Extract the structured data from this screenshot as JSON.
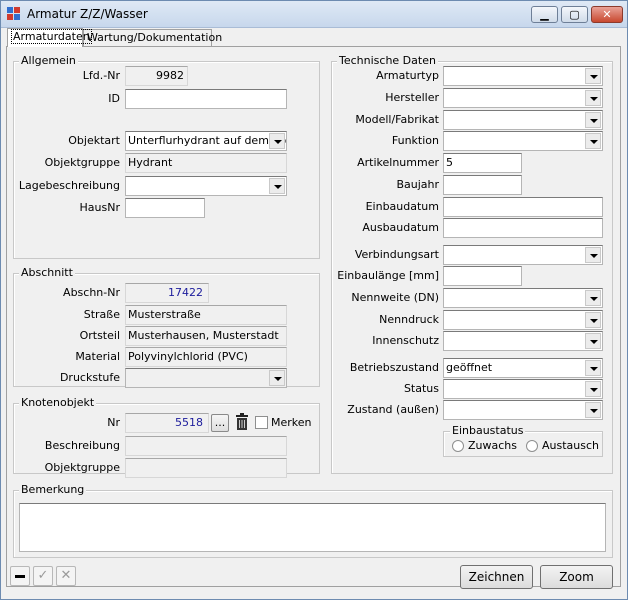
{
  "window": {
    "title": "Armatur Z/Z/Wasser",
    "minimize": "▁",
    "maximize": "▢",
    "close": "✕"
  },
  "tabs": {
    "armaturdaten": "Armaturdaten",
    "wartung": "Wartung/Dokumentation"
  },
  "allgemein": {
    "title": "Allgemein",
    "lfd_nr_label": "Lfd.-Nr",
    "lfd_nr_value": "9982",
    "id_label": "ID",
    "id_value": "",
    "objektart_label": "Objektart",
    "objektart_value": "Unterflurhydrant auf dem Rohr",
    "objektgruppe_label": "Objektgruppe",
    "objektgruppe_value": "Hydrant",
    "lage_label": "Lagebeschreibung",
    "lage_value": "",
    "hausnr_label": "HausNr",
    "hausnr_value": ""
  },
  "abschnitt": {
    "title": "Abschnitt",
    "nr_label": "Abschn-Nr",
    "nr_value": "17422",
    "strasse_label": "Straße",
    "strasse_value": "Musterstraße",
    "ortsteil_label": "Ortsteil",
    "ortsteil_value": "Musterhausen, Musterstadt",
    "material_label": "Material",
    "material_value": "Polyvinylchlorid (PVC)",
    "druckstufe_label": "Druckstufe",
    "druckstufe_value": ""
  },
  "knotenobjekt": {
    "title": "Knotenobjekt",
    "nr_label": "Nr",
    "nr_value": "5518",
    "browse_label": "...",
    "merken_label": "Merken",
    "beschreibung_label": "Beschreibung",
    "beschreibung_value": "",
    "objektgruppe_label": "Objektgruppe",
    "objektgruppe_value": ""
  },
  "technische_daten": {
    "title": "Technische Daten",
    "armaturtyp_label": "Armaturtyp",
    "hersteller_label": "Hersteller",
    "modell_label": "Modell/Fabrikat",
    "funktion_label": "Funktion",
    "artikelnummer_label": "Artikelnummer",
    "artikelnummer_value": "5",
    "baujahr_label": "Baujahr",
    "einbaudatum_label": "Einbaudatum",
    "ausbaudatum_label": "Ausbaudatum",
    "verbindungsart_label": "Verbindungsart",
    "einbaulaenge_label": "Einbaulänge [mm]",
    "nennweite_label": "Nennweite (DN)",
    "nenndruck_label": "Nenndruck",
    "innenschutz_label": "Innenschutz",
    "betriebszustand_label": "Betriebszustand",
    "betriebszustand_value": "geöffnet",
    "status_label": "Status",
    "zustand_label": "Zustand (außen)",
    "einbaustatus_title": "Einbaustatus",
    "zuwachs_label": "Zuwachs",
    "austausch_label": "Austausch"
  },
  "bemerkung": {
    "title": "Bemerkung",
    "value": ""
  },
  "footer": {
    "zeichnen_label": "Zeichnen",
    "zoom_label": "Zoom"
  }
}
